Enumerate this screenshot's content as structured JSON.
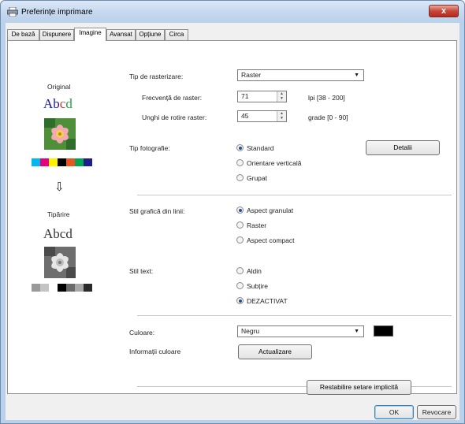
{
  "window": {
    "title": "Preferințe imprimare",
    "close_glyph": "x"
  },
  "tabs": [
    {
      "label": "De bază"
    },
    {
      "label": "Dispunere"
    },
    {
      "label": "Imagine"
    },
    {
      "label": "Avansat"
    },
    {
      "label": "Opțiune"
    },
    {
      "label": "Circa"
    }
  ],
  "preview": {
    "original_label": "Original",
    "original_text": {
      "a": "A",
      "b": "b",
      "c": "c",
      "d": "d"
    },
    "original_colors": [
      "#00b8ef",
      "#e6007e",
      "#fff100",
      "#000000",
      "#e75520",
      "#00a651",
      "#1d2088"
    ],
    "arrow": "⇩",
    "print_label": "Tipărire",
    "print_text": "Abcd",
    "print_colors": [
      "#9a9a9a",
      "#c4c4c4",
      "#ffffff",
      "#000000",
      "#6a6a6a",
      "#a8a8a8",
      "#2a2a2a"
    ]
  },
  "raster": {
    "type_label": "Tip de rasterizare:",
    "type_value": "Raster",
    "freq_label": "Frecvență de raster:",
    "freq_value": "71",
    "freq_unit": "lpi [38 - 200]",
    "angle_label": "Unghi de rotire raster:",
    "angle_value": "45",
    "angle_unit": "grade [0 - 90]"
  },
  "photo_type": {
    "label": "Tip fotografie:",
    "options": [
      "Standard",
      "Orientare verticală",
      "Grupat"
    ],
    "selected": 0,
    "details_button": "Detalii"
  },
  "line_graphics": {
    "label": "Stil grafică din linii:",
    "options": [
      "Aspect granulat",
      "Raster",
      "Aspect compact"
    ],
    "selected": 0
  },
  "text_style": {
    "label": "Stil text:",
    "options": [
      "Aldin",
      "Subțire",
      "DEZACTIVAT"
    ],
    "selected": 2
  },
  "color": {
    "label": "Culoare:",
    "value": "Negru",
    "swatch": "#000000",
    "info_label": "Informații culoare",
    "update_button": "Actualizare"
  },
  "restore_button": "Restabilire setare implicită",
  "footer": {
    "ok": "OK",
    "cancel": "Revocare"
  },
  "icons": {
    "window_icon": "printer-icon",
    "dropdown": "chevron-down-icon",
    "spin": "spin-arrows-icon"
  }
}
